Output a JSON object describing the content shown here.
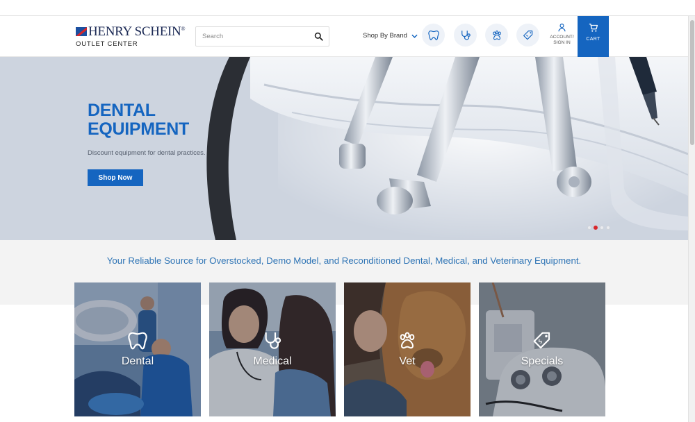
{
  "header": {
    "logo_main": "HENRY SCHEIN",
    "logo_mark": "®",
    "logo_sub": "OUTLET CENTER",
    "search_placeholder": "Search",
    "shop_by_brand": "Shop By Brand",
    "category_icons": [
      "tooth-icon",
      "stethoscope-icon",
      "paw-icon",
      "tag-icon"
    ],
    "account_label": "ACCOUNT/\nSIGN IN",
    "cart_label": "CART"
  },
  "hero": {
    "title": "DENTAL\nEQUIPMENT",
    "subtitle": "Discount equipment for dental practices.",
    "button": "Shop Now",
    "slide_count": 4,
    "active_slide": 2
  },
  "tagline": "Your Reliable Source for Overstocked, Demo Model, and Reconditioned Dental, Medical, and Veterinary Equipment.",
  "categories": [
    {
      "label": "Dental",
      "icon": "tooth-icon"
    },
    {
      "label": "Medical",
      "icon": "stethoscope-icon"
    },
    {
      "label": "Vet",
      "icon": "paw-icon"
    },
    {
      "label": "Specials",
      "icon": "tag-icon"
    }
  ],
  "colors": {
    "brand_blue": "#1565c0",
    "tagline_blue": "#2e74b5",
    "active_dot": "#d8262a",
    "logo_navy": "#1c2a55"
  }
}
